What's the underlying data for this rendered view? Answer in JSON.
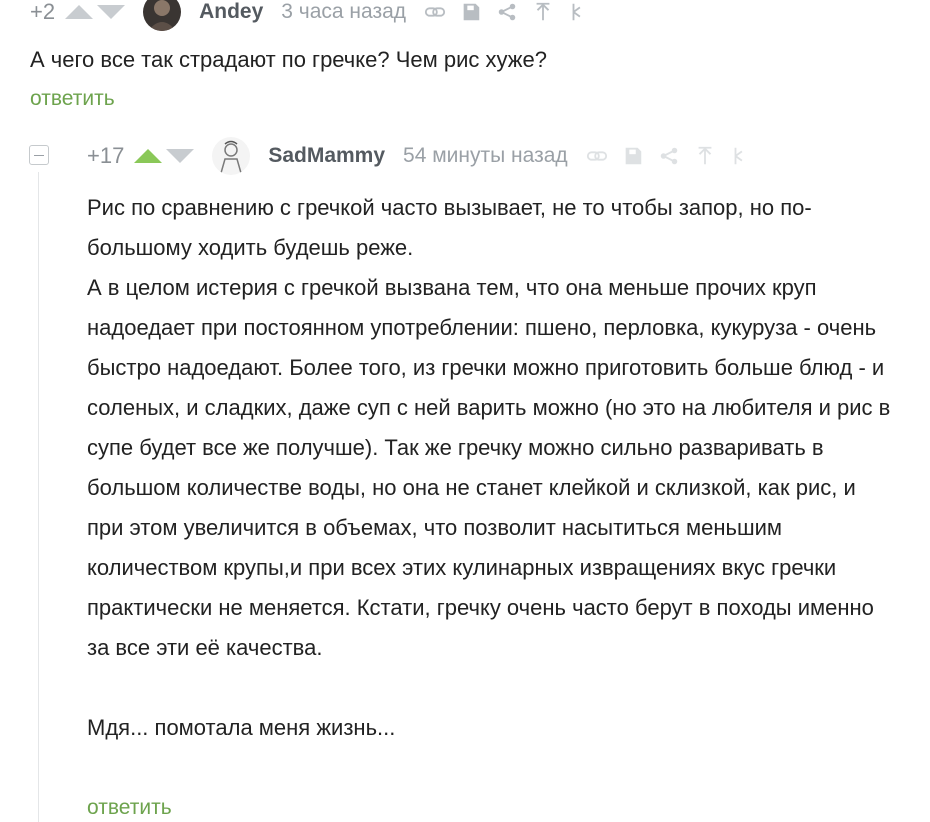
{
  "comment1": {
    "rating": "+2",
    "author": "Andey",
    "time": "3 часа назад",
    "text": "А чего все так страдают по гречке? Чем рис хуже?",
    "reply_label": "ответить"
  },
  "comment2": {
    "rating": "+17",
    "author": "SadMammy",
    "time": "54 минуты назад",
    "paragraphs": [
      "Рис по сравнению с гречкой часто вызывает, не то чтобы запор, но по-большому ходить будешь реже.",
      "А в целом истерия с гречкой вызвана тем, что она меньше прочих круп надоедает при постоянном употреблении: пшено, перловка, кукуруза - очень быстро надоедают. Более того, из гречки можно приготовить больше блюд - и соленых, и сладких, даже суп с ней варить можно (но это на любителя и рис в супе будет все же получше). Так же гречку можно сильно разваривать в большом количестве воды, но она не станет клейкой и склизкой, как рис, и при этом увеличится в объемах, что позволит насытиться меньшим количеством крупы,и при всех этих кулинарных извращениях вкус гречки практически не меняется. Кстати, гречку очень часто берут в походы именно за все эти её качества.",
      "",
      "Мдя... помотала меня жизнь..."
    ],
    "reply_label": "ответить"
  },
  "icons": [
    "link-icon",
    "save-icon",
    "share-icon",
    "arrow-up-icon",
    "hierarchy-icon"
  ],
  "colors": {
    "upvote_active": "#8ac858",
    "reply_link": "#6da34d",
    "meta_text": "#9aa0a6"
  }
}
